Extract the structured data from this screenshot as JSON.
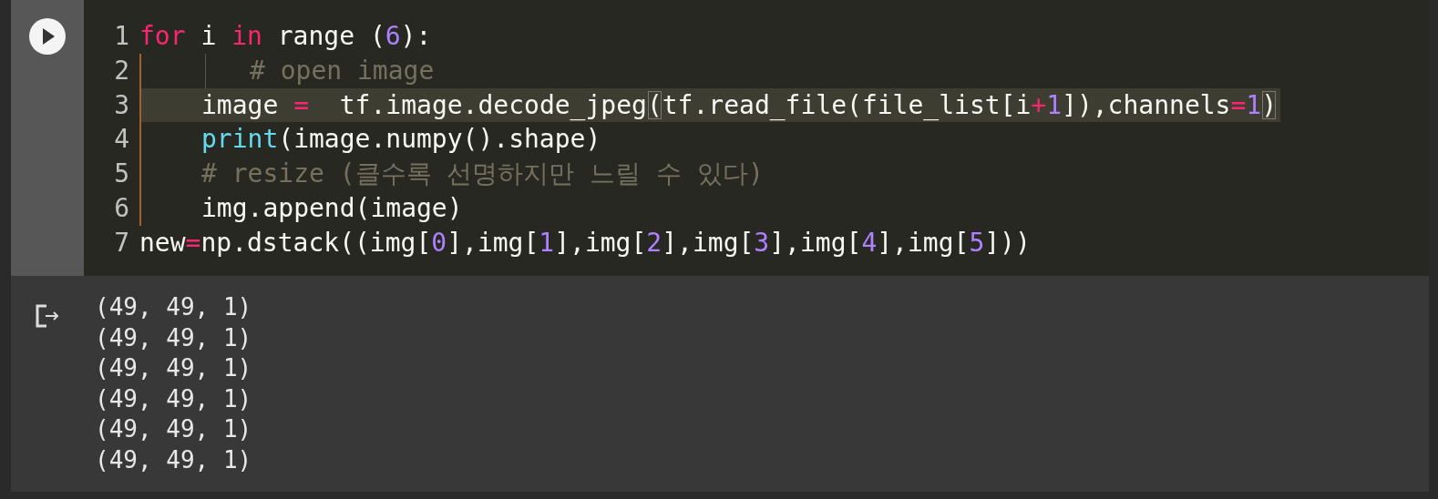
{
  "cell": {
    "lines": [
      {
        "number": "1",
        "active": false,
        "tokens": [
          {
            "kind": "keyword",
            "text": "for"
          },
          {
            "kind": "plain",
            "text": " i "
          },
          {
            "kind": "keyword",
            "text": "in"
          },
          {
            "kind": "plain",
            "text": " range ("
          },
          {
            "kind": "number",
            "text": "6"
          },
          {
            "kind": "plain",
            "text": "):"
          }
        ],
        "children": [
          {
            "number": "2",
            "active": false,
            "guide": true,
            "tokens": [
              {
                "kind": "comment",
                "text": "# open image"
              }
            ]
          },
          {
            "number": "3",
            "active": true,
            "tokens": [
              {
                "kind": "plain",
                "text": "image "
              },
              {
                "kind": "operator",
                "text": "="
              },
              {
                "kind": "plain",
                "text": "  tf.image.decode_jpeg"
              },
              {
                "kind": "match",
                "text": "("
              },
              {
                "kind": "plain",
                "text": "tf.read_file(file_list[i"
              },
              {
                "kind": "operator",
                "text": "+"
              },
              {
                "kind": "number",
                "text": "1"
              },
              {
                "kind": "plain",
                "text": "]),channels"
              },
              {
                "kind": "operator",
                "text": "="
              },
              {
                "kind": "number",
                "text": "1"
              },
              {
                "kind": "match",
                "text": ")"
              }
            ]
          },
          {
            "number": "4",
            "active": false,
            "tokens": [
              {
                "kind": "builtin",
                "text": "print"
              },
              {
                "kind": "plain",
                "text": "(image.numpy().shape)"
              }
            ]
          },
          {
            "number": "5",
            "active": false,
            "tokens": [
              {
                "kind": "comment",
                "text": "# resize (클수록 선명하지만 느릴 수 있다)"
              }
            ]
          },
          {
            "number": "6",
            "active": false,
            "tokens": [
              {
                "kind": "plain",
                "text": "img.append(image)"
              }
            ]
          }
        ]
      },
      {
        "number": "7",
        "active": false,
        "tokens": [
          {
            "kind": "plain",
            "text": "new"
          },
          {
            "kind": "operator",
            "text": "="
          },
          {
            "kind": "plain",
            "text": "np.dstack((img["
          },
          {
            "kind": "number",
            "text": "0"
          },
          {
            "kind": "plain",
            "text": "],img["
          },
          {
            "kind": "number",
            "text": "1"
          },
          {
            "kind": "plain",
            "text": "],img["
          },
          {
            "kind": "number",
            "text": "2"
          },
          {
            "kind": "plain",
            "text": "],img["
          },
          {
            "kind": "number",
            "text": "3"
          },
          {
            "kind": "plain",
            "text": "],img["
          },
          {
            "kind": "number",
            "text": "4"
          },
          {
            "kind": "plain",
            "text": "],img["
          },
          {
            "kind": "number",
            "text": "5"
          },
          {
            "kind": "plain",
            "text": "]))"
          }
        ]
      }
    ]
  },
  "output": {
    "lines": [
      "(49, 49, 1)",
      "(49, 49, 1)",
      "(49, 49, 1)",
      "(49, 49, 1)",
      "(49, 49, 1)",
      "(49, 49, 1)"
    ]
  }
}
